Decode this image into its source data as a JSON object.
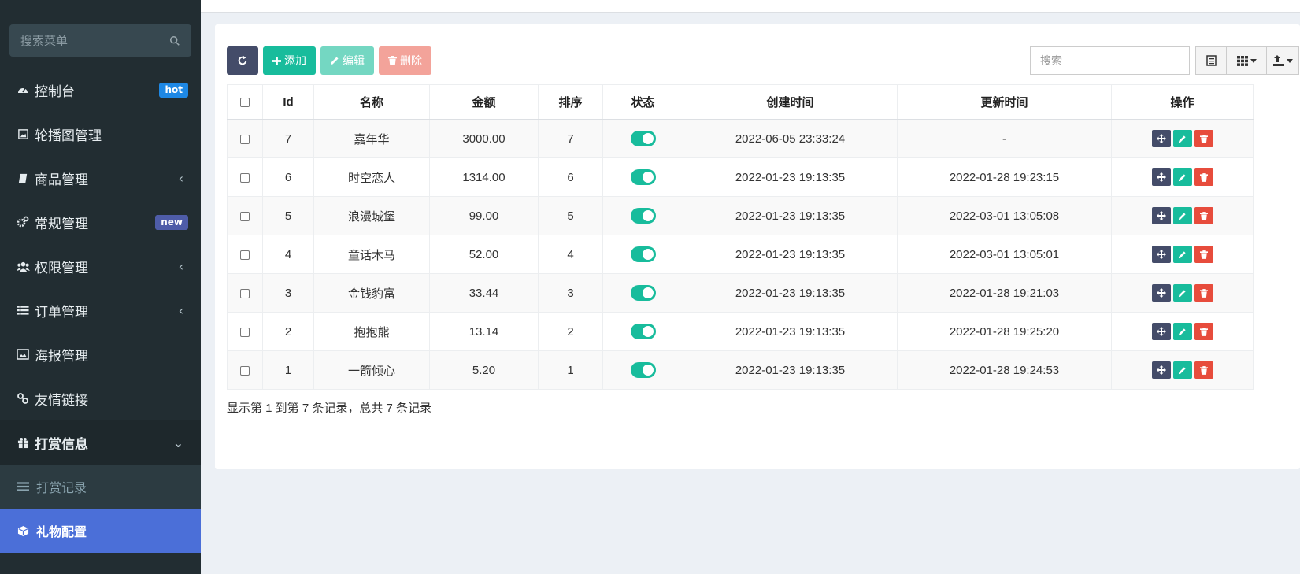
{
  "sidebar": {
    "search_placeholder": "搜索菜单",
    "items": [
      {
        "label": "控制台",
        "badge": "hot"
      },
      {
        "label": "轮播图管理"
      },
      {
        "label": "商品管理",
        "chevron": "‹"
      },
      {
        "label": "常规管理",
        "badge": "new"
      },
      {
        "label": "权限管理",
        "chevron": "‹"
      },
      {
        "label": "订单管理",
        "chevron": "‹"
      },
      {
        "label": "海报管理"
      },
      {
        "label": "友情链接"
      },
      {
        "label": "打赏信息",
        "chevron": "⌄"
      }
    ],
    "sub_items": [
      {
        "label": "打赏记录"
      },
      {
        "label": "礼物配置"
      }
    ]
  },
  "toolbar": {
    "add_label": "添加",
    "edit_label": "编辑",
    "delete_label": "删除",
    "search_placeholder": "搜索"
  },
  "table": {
    "headers": [
      "Id",
      "名称",
      "金额",
      "排序",
      "状态",
      "创建时间",
      "更新时间",
      "操作"
    ],
    "rows": [
      {
        "id": "7",
        "name": "嘉年华",
        "amount": "3000.00",
        "sort": "7",
        "created": "2022-06-05 23:33:24",
        "updated": "-"
      },
      {
        "id": "6",
        "name": "时空恋人",
        "amount": "1314.00",
        "sort": "6",
        "created": "2022-01-23 19:13:35",
        "updated": "2022-01-28 19:23:15"
      },
      {
        "id": "5",
        "name": "浪漫城堡",
        "amount": "99.00",
        "sort": "5",
        "created": "2022-01-23 19:13:35",
        "updated": "2022-03-01 13:05:08"
      },
      {
        "id": "4",
        "name": "童话木马",
        "amount": "52.00",
        "sort": "4",
        "created": "2022-01-23 19:13:35",
        "updated": "2022-03-01 13:05:01"
      },
      {
        "id": "3",
        "name": "金钱豹富",
        "amount": "33.44",
        "sort": "3",
        "created": "2022-01-23 19:13:35",
        "updated": "2022-01-28 19:21:03"
      },
      {
        "id": "2",
        "name": "抱抱熊",
        "amount": "13.14",
        "sort": "2",
        "created": "2022-01-23 19:13:35",
        "updated": "2022-01-28 19:25:20"
      },
      {
        "id": "1",
        "name": "一箭倾心",
        "amount": "5.20",
        "sort": "1",
        "created": "2022-01-23 19:13:35",
        "updated": "2022-01-28 19:24:53"
      }
    ]
  },
  "pagination_text": "显示第 1 到第 7 条记录，总共 7 条记录",
  "colors": {
    "sidebar_bg": "#222d32",
    "accent_green": "#18bc9c",
    "accent_dark": "#444c69",
    "danger": "#e74c3c",
    "active_menu": "#4b6fd8"
  }
}
